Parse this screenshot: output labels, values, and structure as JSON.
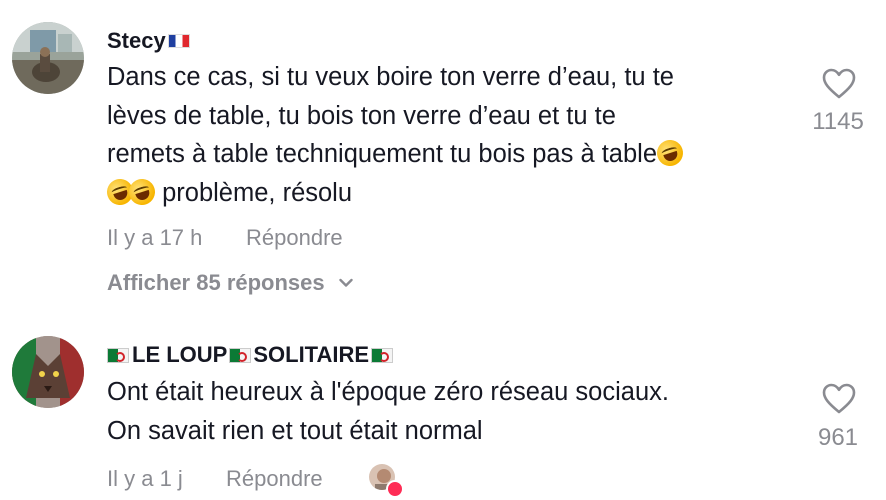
{
  "comments": [
    {
      "username": "Stecy",
      "username_flag": "flag-france",
      "lines": [
        "Dans ce cas, si tu veux boire ton verre d’eau, tu te",
        "lèves de table, tu bois ton verre d’eau et tu te",
        "remets à table techniquement tu bois pas à table",
        "problème, résolu"
      ],
      "emoji": "rolling-on-floor-laughing",
      "time": "Il y a 17 h",
      "reply_label": "Répondre",
      "like_count": "1145",
      "show_replies_label": "Afficher 85 réponses"
    },
    {
      "username_part1": "LE LOUP",
      "username_part2": "SOLITAIRE",
      "username_flag": "flag-algeria",
      "lines": [
        "Ont était heureux à l'époque zéro réseau sociaux.",
        "On savait rien et tout était normal"
      ],
      "time": "Il y a 1 j",
      "reply_label": "Répondre",
      "like_count": "961"
    }
  ],
  "colors": {
    "text": "#161823",
    "muted": "#8a8b91",
    "heart_badge": "#fe2c55"
  }
}
